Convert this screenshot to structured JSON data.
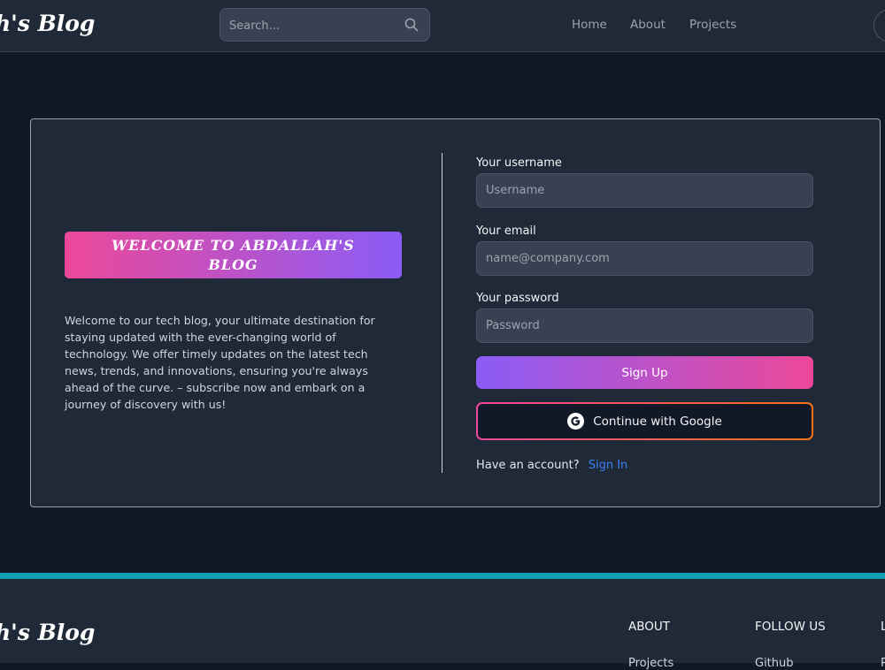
{
  "header": {
    "brand": "h's Blog",
    "search_placeholder": "Search...",
    "nav": [
      "Home",
      "About",
      "Projects"
    ]
  },
  "welcome": {
    "banner": "WELCOME TO ABDALLAH'S BLOG",
    "intro": "Welcome to our tech blog, your ultimate destination for staying updated with the ever-changing world of technology. We offer timely updates on the latest tech news, trends, and innovations, ensuring you're always ahead of the curve. – subscribe now and embark on a journey of discovery with us!"
  },
  "form": {
    "username_label": "Your username",
    "username_placeholder": "Username",
    "email_label": "Your email",
    "email_placeholder": "name@company.com",
    "password_label": "Your password",
    "password_placeholder": "Password",
    "signup_button": "Sign Up",
    "google_button": "Continue with Google",
    "have_account": "Have an account?",
    "signin_link": "Sign In"
  },
  "footer": {
    "brand": "h's Blog",
    "about_heading": "ABOUT",
    "follow_heading": "FOLLOW US",
    "partial_heading": "L",
    "about_link": "Projects",
    "follow_link": "Github",
    "partial_link": "P"
  },
  "colors": {
    "page_bg": "#111827",
    "panel_bg": "#1f2937",
    "accent_pink": "#ec4899",
    "accent_purple": "#8b5cf6",
    "link_blue": "#3b82f6",
    "footer_border": "#0e9fb4"
  }
}
